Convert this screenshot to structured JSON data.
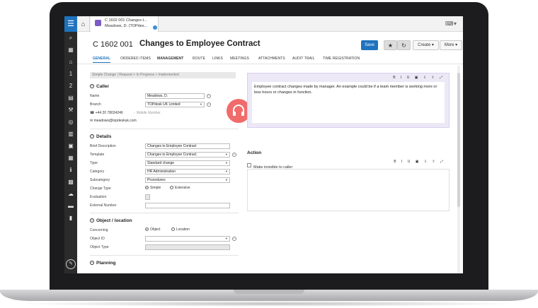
{
  "tab": {
    "line1": "C 1602 001 Changes t...",
    "line2": "Meadows, D. (TOPdes..."
  },
  "header": {
    "id": "C 1602 001",
    "title": "Changes to Employee Contract",
    "save": "Save",
    "create": "Create",
    "more": "More"
  },
  "tabs": [
    "GENERAL",
    "ORDERED ITEMS",
    "MANAGEMENT",
    "ROUTE",
    "LINKS",
    "MEETINGS",
    "ATTACHMENTS",
    "AUDIT TRAIL",
    "TIME REGISTRATION"
  ],
  "breadcrumb": "Simple Change  |  Request  >  In Progress  >  Implemented",
  "caller": {
    "section": "Caller",
    "name_label": "Name",
    "name_value": "Meadows, D.",
    "branch_label": "Branch",
    "branch_value": "TOPdesk UK Limited",
    "phone": "+44 20 78034246",
    "mobile_hint": "Mobile Number",
    "email": "meadows@topdeskuk.com"
  },
  "details": {
    "section": "Details",
    "brief_label": "Brief Description",
    "brief_value": "Changes to Employee Contract",
    "template_label": "Template",
    "template_value": "Changes to Employee Contract",
    "type_label": "Type",
    "type_value": "Standard change",
    "category_label": "Category",
    "category_value": "HR Administration",
    "subcategory_label": "Subcategory",
    "subcategory_value": "Procedures",
    "changetype_label": "Change Type",
    "opt_simple": "Simple",
    "opt_extensive": "Extensive",
    "evaluation_label": "Evaluation",
    "external_label": "External Number"
  },
  "object": {
    "section": "Object / location",
    "concerning_label": "Concerning",
    "opt_object": "Object",
    "opt_location": "Location",
    "objectid_label": "Object ID",
    "objecttype_label": "Object Type"
  },
  "planning": {
    "section": "Planning"
  },
  "request": {
    "toolbar": "B I U ▣ ⇩ ⇧ ⤢",
    "text": "Employee contract changes made by manager. An example could be if a team member is working more or less hours or changes in function."
  },
  "action": {
    "title": "Action",
    "invisible_label": "Make invisible to caller",
    "toolbar": "B I U ▣ ⇩ ⇧ ⤢"
  },
  "colors": {
    "primary": "#1e73be",
    "headset": "#f26b6b",
    "request_bg": "#ece8f6",
    "sidebar": "#2b2b2b"
  }
}
